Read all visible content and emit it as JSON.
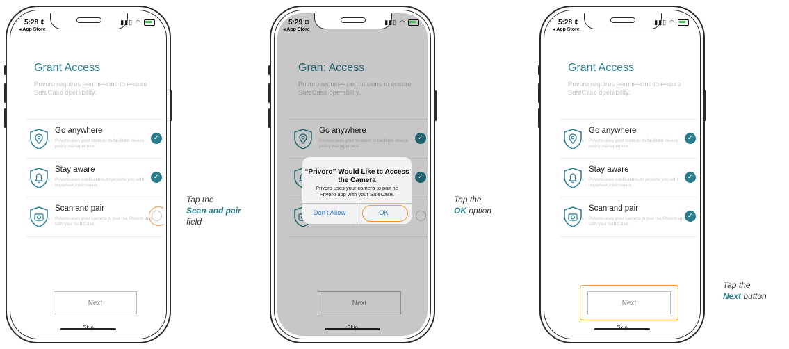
{
  "status": {
    "time_1": "5:28 ⯐",
    "time_2": "5:29 ⯐",
    "time_3": "5:28 ⯐",
    "back_label": "◂ App Store",
    "icons": "▮▮▯ ◠"
  },
  "screen": {
    "title_1": "Grant Access",
    "title_2": "Gran: Access",
    "subtitle": "Privoro requires permissions to ensure SafeCase operability.",
    "permissions": [
      {
        "label": "Go anywhere",
        "desc": "Privoro uses your location to facilitate device policy management.",
        "icon": "location-shield-icon"
      },
      {
        "label": "Stay aware",
        "desc": "Privoro uses notifications to provide you with important information.",
        "icon": "bell-shield-icon"
      },
      {
        "label": "Scan and pair",
        "desc": "Privoro uses your camera to pair the Privoro app with your SafeCase.",
        "icon": "camera-shield-icon"
      }
    ],
    "perm2_label_obscured": "Gc anywhere",
    "perm3_desc_obscured": "Privoro app with your SafeCase.",
    "next_label": "Next",
    "skip_label": "Skip",
    "check_glyph": "✓"
  },
  "dialog": {
    "title": "“Privoro” Would Like tc Access the Camera",
    "body": "Privoro uses your camera to pair he Frivoro app with your SafeCase.",
    "dont_allow": "Don't Allow",
    "ok": "OK"
  },
  "captions": {
    "c1_pre": "Tap the",
    "c1_bold": "Scan and pair",
    "c1_post": "field",
    "c2_pre": "Tap the",
    "c2_bold": "OK",
    "c2_post": "option",
    "c3_pre": "Tap the",
    "c3_bold": "Next",
    "c3_post": "button"
  },
  "colors": {
    "accent": "#2a7f8f",
    "highlight": "#f09a3c",
    "check": "#2b7c8c",
    "ios_blue": "#2c7bd6"
  }
}
